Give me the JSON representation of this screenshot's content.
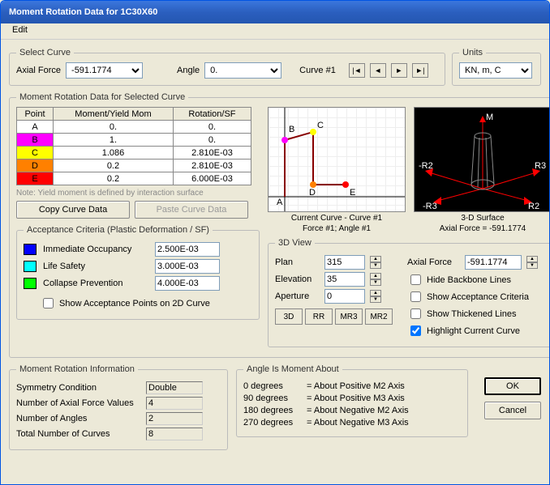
{
  "title": "Moment Rotation Data for 1C30X60",
  "menu": {
    "edit": "Edit"
  },
  "selectCurve": {
    "legend": "Select Curve",
    "axialForceLabel": "Axial Force",
    "axialForceValue": "-591.1774",
    "angleLabel": "Angle",
    "angleValue": "0.",
    "curveLabel": "Curve #1"
  },
  "units": {
    "legend": "Units",
    "value": "KN, m, C"
  },
  "dataLegend": "Moment Rotation Data for Selected Curve",
  "tableHeaders": {
    "point": "Point",
    "moment": "Moment/Yield Mom",
    "rotation": "Rotation/SF"
  },
  "points": [
    {
      "id": "A",
      "m": "0.",
      "r": "0."
    },
    {
      "id": "B",
      "m": "1.",
      "r": "0."
    },
    {
      "id": "C",
      "m": "1.086",
      "r": "2.810E-03"
    },
    {
      "id": "D",
      "m": "0.2",
      "r": "2.810E-03"
    },
    {
      "id": "E",
      "m": "0.2",
      "r": "6.000E-03"
    }
  ],
  "note": "Note:  Yield moment is defined by interaction surface",
  "copyBtn": "Copy Curve Data",
  "pasteBtn": "Paste Curve Data",
  "currentCurveCaption1": "Current Curve - Curve #1",
  "currentCurveCaption2": "Force #1;  Angle #1",
  "surfaceCaption1": "3-D Surface",
  "surfaceCaption2": "Axial Force = -591.1774",
  "surfaceLabels": {
    "M": "M",
    "R2": "R2",
    "R3": "R3",
    "nR2": "-R2",
    "nR3": "-R3"
  },
  "acceptance": {
    "legend": "Acceptance Criteria (Plastic Deformation / SF)",
    "io": {
      "label": "Immediate Occupancy",
      "value": "2.500E-03",
      "color": "#0000FF"
    },
    "ls": {
      "label": "Life Safety",
      "value": "3.000E-03",
      "color": "#00FFFF"
    },
    "cp": {
      "label": "Collapse Prevention",
      "value": "4.000E-03",
      "color": "#00FF00"
    },
    "showPoints": "Show Acceptance Points on 2D Curve"
  },
  "view3d": {
    "legend": "3D View",
    "planLabel": "Plan",
    "plan": "315",
    "elevLabel": "Elevation",
    "elev": "35",
    "apLabel": "Aperture",
    "ap": "0",
    "btn3D": "3D",
    "btnRR": "RR",
    "btnMR3": "MR3",
    "btnMR2": "MR2",
    "axialLabel": "Axial Force",
    "axial": "-591.1774",
    "hideBackbone": "Hide Backbone Lines",
    "showAcc": "Show Acceptance Criteria",
    "showThick": "Show Thickened Lines",
    "highlight": "Highlight Current Curve"
  },
  "info": {
    "legend": "Moment Rotation Information",
    "sym": {
      "label": "Symmetry Condition",
      "value": "Double"
    },
    "naf": {
      "label": "Number of Axial Force Values",
      "value": "4"
    },
    "na": {
      "label": "Number of Angles",
      "value": "2"
    },
    "tot": {
      "label": "Total Number of Curves",
      "value": "8"
    }
  },
  "angleAbout": {
    "legend": "Angle Is Moment About",
    "rows": [
      {
        "a": "0 degrees",
        "b": "=  About Positive M2 Axis"
      },
      {
        "a": "90 degrees",
        "b": "=  About Positive M3 Axis"
      },
      {
        "a": "180 degrees",
        "b": "=  About Negative M2 Axis"
      },
      {
        "a": "270 degrees",
        "b": "=  About Negative M3 Axis"
      }
    ]
  },
  "ok": "OK",
  "cancel": "Cancel"
}
